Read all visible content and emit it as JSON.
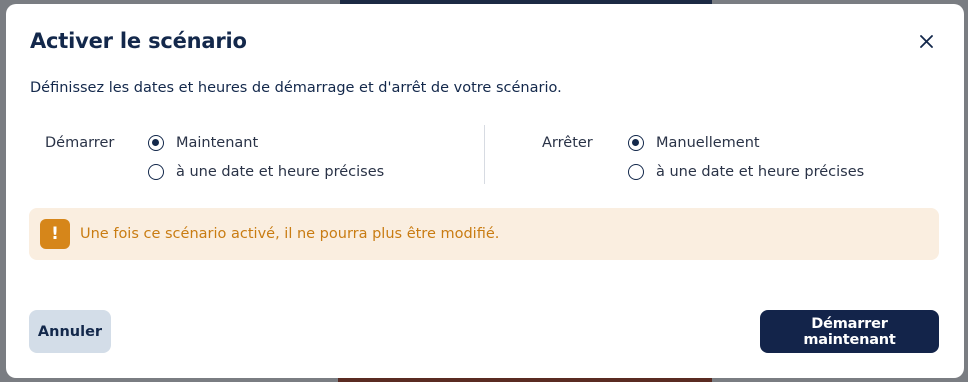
{
  "dialog": {
    "title": "Activer le scénario",
    "close_icon": "close-icon",
    "description": "Définissez les dates et heures de démarrage et d'arrêt de votre scénario."
  },
  "start": {
    "label": "Démarrer",
    "options": [
      {
        "label": "Maintenant",
        "checked": true
      },
      {
        "label": "à une date et heure précises",
        "checked": false
      }
    ]
  },
  "stop": {
    "label": "Arrêter",
    "options": [
      {
        "label": "Manuellement",
        "checked": true
      },
      {
        "label": "à une date et heure précises",
        "checked": false
      }
    ]
  },
  "warning": {
    "icon": "exclamation-icon",
    "symbol": "!",
    "text": "Une fois ce scénario activé, il ne pourra plus être modifié."
  },
  "footer": {
    "cancel_label": "Annuler",
    "start_label": "Démarrer maintenant"
  },
  "colors": {
    "primary": "#13244a",
    "warning_bg": "#faeee0",
    "warning_accent": "#d6861a",
    "cancel_bg": "#d3dde8"
  }
}
